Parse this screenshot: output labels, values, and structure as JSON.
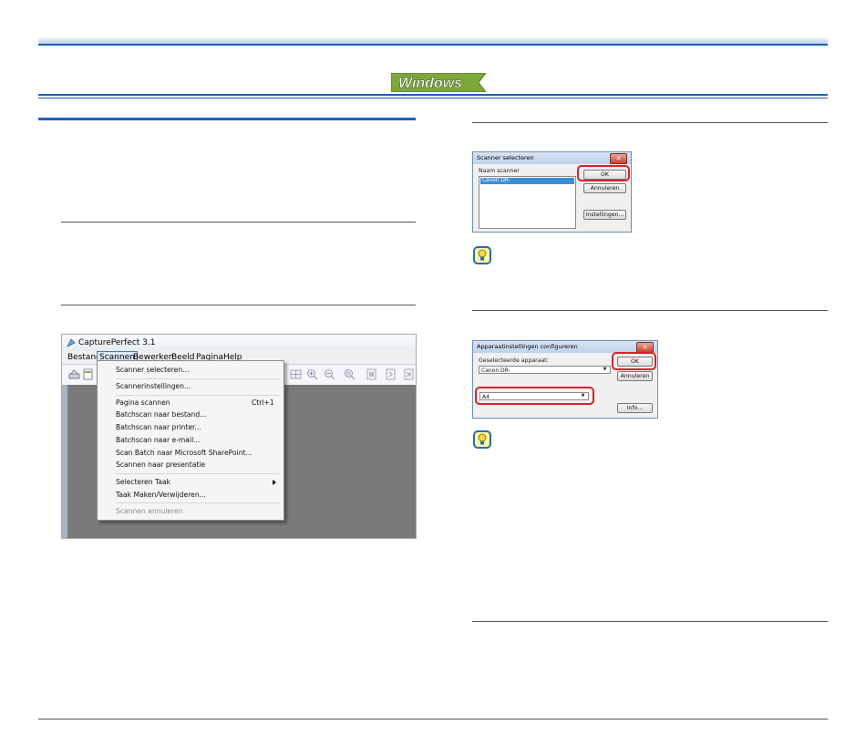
{
  "header": {
    "os_badge_text": "Windows"
  },
  "capture_window": {
    "title": "CapturePerfect 3.1",
    "menubar": [
      "Bestand",
      "Scannen",
      "Bewerken",
      "Beeld",
      "Pagina",
      "Help"
    ],
    "selected_menu": "Scannen",
    "menu_items": [
      {
        "label": "Scanner selecteren..."
      },
      {
        "label": "Scannerinstellingen..."
      },
      {
        "label": "Pagina scannen",
        "shortcut": "Ctrl+1"
      },
      {
        "label": "Batchscan naar bestand..."
      },
      {
        "label": "Batchscan naar printer..."
      },
      {
        "label": "Batchscan naar e-mail..."
      },
      {
        "label": "Scan Batch naar Microsoft SharePoint..."
      },
      {
        "label": "Scannen naar presentatie"
      },
      {
        "label": "Selecteren Taak"
      },
      {
        "label": "Taak Maken/Verwijderen..."
      },
      {
        "label": "Scannen annuleren"
      }
    ]
  },
  "dialog_select": {
    "title": "Scanner selecteren",
    "list_label": "Naam scanner",
    "selected_item": "Canon DR-",
    "ok_button": "OK",
    "cancel_button": "Annuleren",
    "settings_button": "Instellingen..."
  },
  "dialog_configure": {
    "title": "Apparaatinstellingen configureren",
    "device_label": "Geselecteerde apparaat:",
    "device_value": "Canon DR-",
    "paper_value": "A4",
    "ok_button": "OK",
    "cancel_button": "Annuleren",
    "info_button": "Info..."
  },
  "colors": {
    "accent_blue": "#1d5fc4",
    "highlight_red": "#d2232a",
    "badge_green": "#7da83a"
  }
}
